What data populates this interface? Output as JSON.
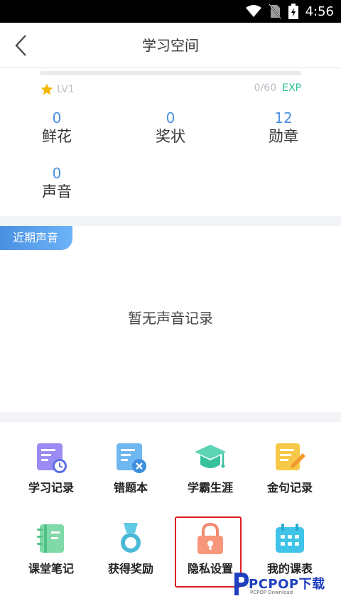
{
  "status_bar": {
    "time": "4:56"
  },
  "header": {
    "title": "学习空间"
  },
  "profile": {
    "level": "LV1",
    "exp_value": "0/60",
    "exp_label": "EXP",
    "exp_fraction": 0,
    "stats": [
      {
        "value": "0",
        "label": "鲜花"
      },
      {
        "value": "0",
        "label": "奖状"
      },
      {
        "value": "12",
        "label": "勋章"
      },
      {
        "value": "0",
        "label": "声音"
      }
    ]
  },
  "recent": {
    "tag": "近期声音",
    "empty_text": "暂无声音记录"
  },
  "grid": {
    "items": [
      {
        "label": "学习记录",
        "icon": "study-record-icon"
      },
      {
        "label": "错题本",
        "icon": "wrong-questions-icon"
      },
      {
        "label": "学霸生涯",
        "icon": "graduation-cap-icon"
      },
      {
        "label": "金句记录",
        "icon": "quote-notes-icon"
      },
      {
        "label": "课堂笔记",
        "icon": "notebook-icon"
      },
      {
        "label": "获得奖励",
        "icon": "medal-icon"
      },
      {
        "label": "隐私设置",
        "icon": "lock-icon"
      },
      {
        "label": "我的课表",
        "icon": "calendar-icon"
      }
    ]
  },
  "watermark": {
    "text": "PCPOP下载",
    "sub": "PCPOP Download"
  },
  "colors": {
    "accent": "#4a90e2",
    "exp": "#27c29a",
    "highlight": "#e11d24"
  }
}
